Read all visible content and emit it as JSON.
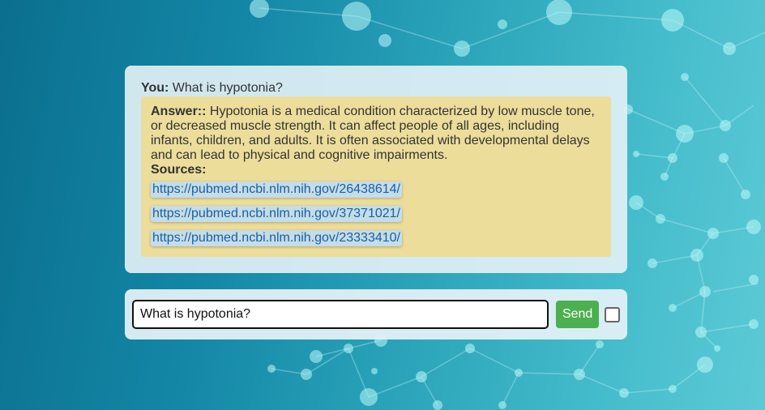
{
  "chat": {
    "you_label": "You:",
    "question": " What is hypotonia?",
    "answer_label": "Answer::",
    "answer_text": " Hypotonia is a medical condition characterized by low muscle tone, or decreased muscle strength. It can affect people of all ages, including infants, children, and adults. It is often associated with developmental delays and can lead to physical and cognitive impairments.",
    "sources_label": "Sources:",
    "sources": [
      "https://pubmed.ncbi.nlm.nih.gov/26438614/",
      "https://pubmed.ncbi.nlm.nih.gov/37371021/",
      "https://pubmed.ncbi.nlm.nih.gov/23333410/"
    ]
  },
  "input": {
    "value": "What is hypotonia?",
    "send_label": "Send",
    "checkbox_checked": false
  },
  "colors": {
    "answer_bg": "#ecdd9b",
    "send_bg": "#4caf50",
    "link": "#1a5fa8"
  }
}
